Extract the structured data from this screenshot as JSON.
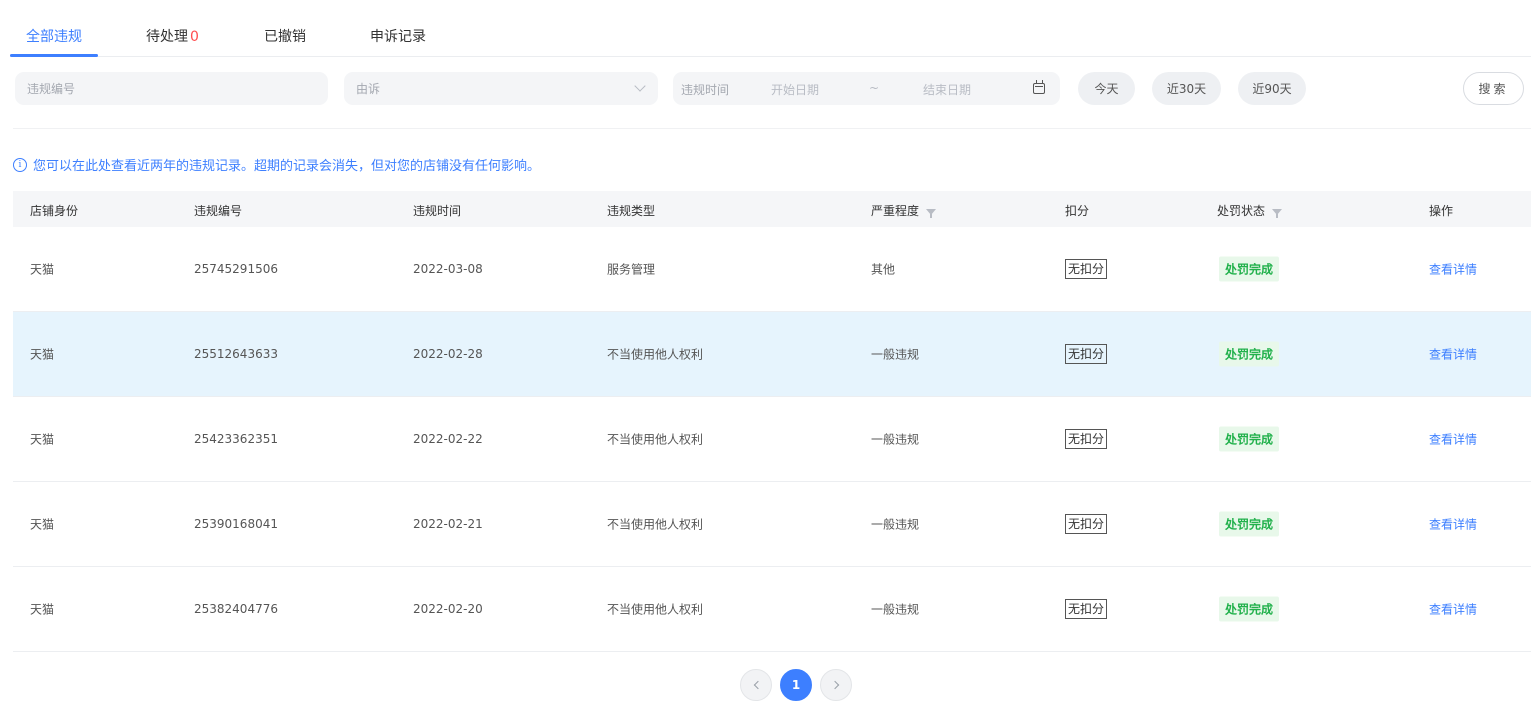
{
  "tabs": {
    "all": "全部违规",
    "pending": "待处理",
    "pending_count": "0",
    "revoked": "已撤销",
    "appeals": "申诉记录"
  },
  "filters": {
    "violation_id_placeholder": "违规编号",
    "appeal_select": "由诉",
    "date_label": "违规时间",
    "start_placeholder": "开始日期",
    "separator": "~",
    "end_placeholder": "结束日期",
    "today": "今天",
    "last30": "近30天",
    "last90": "近90天",
    "search": "搜索"
  },
  "notice": {
    "icon": "info-icon",
    "text": "您可以在此处查看近两年的违规记录。超期的记录会消失，但对您的店铺没有任何影响。"
  },
  "table": {
    "headers": {
      "store": "店铺身份",
      "id": "违规编号",
      "time": "违规时间",
      "type": "违规类型",
      "severity": "严重程度",
      "deduction": "扣分",
      "status": "处罚状态",
      "action": "操作"
    },
    "rows": [
      {
        "store": "天猫",
        "id": "25745291506",
        "time": "2022-03-08",
        "type": "服务管理",
        "severity": "其他",
        "deduction": "无扣分",
        "status": "处罚完成",
        "action": "查看详情"
      },
      {
        "store": "天猫",
        "id": "25512643633",
        "time": "2022-02-28",
        "type": "不当使用他人权利",
        "severity": "一般违规",
        "deduction": "无扣分",
        "status": "处罚完成",
        "action": "查看详情"
      },
      {
        "store": "天猫",
        "id": "25423362351",
        "time": "2022-02-22",
        "type": "不当使用他人权利",
        "severity": "一般违规",
        "deduction": "无扣分",
        "status": "处罚完成",
        "action": "查看详情"
      },
      {
        "store": "天猫",
        "id": "25390168041",
        "time": "2022-02-21",
        "type": "不当使用他人权利",
        "severity": "一般违规",
        "deduction": "无扣分",
        "status": "处罚完成",
        "action": "查看详情"
      },
      {
        "store": "天猫",
        "id": "25382404776",
        "time": "2022-02-20",
        "type": "不当使用他人权利",
        "severity": "一般违规",
        "deduction": "无扣分",
        "status": "处罚完成",
        "action": "查看详情"
      }
    ]
  },
  "pagination": {
    "current": "1"
  },
  "colors": {
    "accent": "#3d7fff",
    "alert": "#ff4d4f",
    "success": "#22b14c",
    "row_highlight": "#e6f4fd"
  }
}
